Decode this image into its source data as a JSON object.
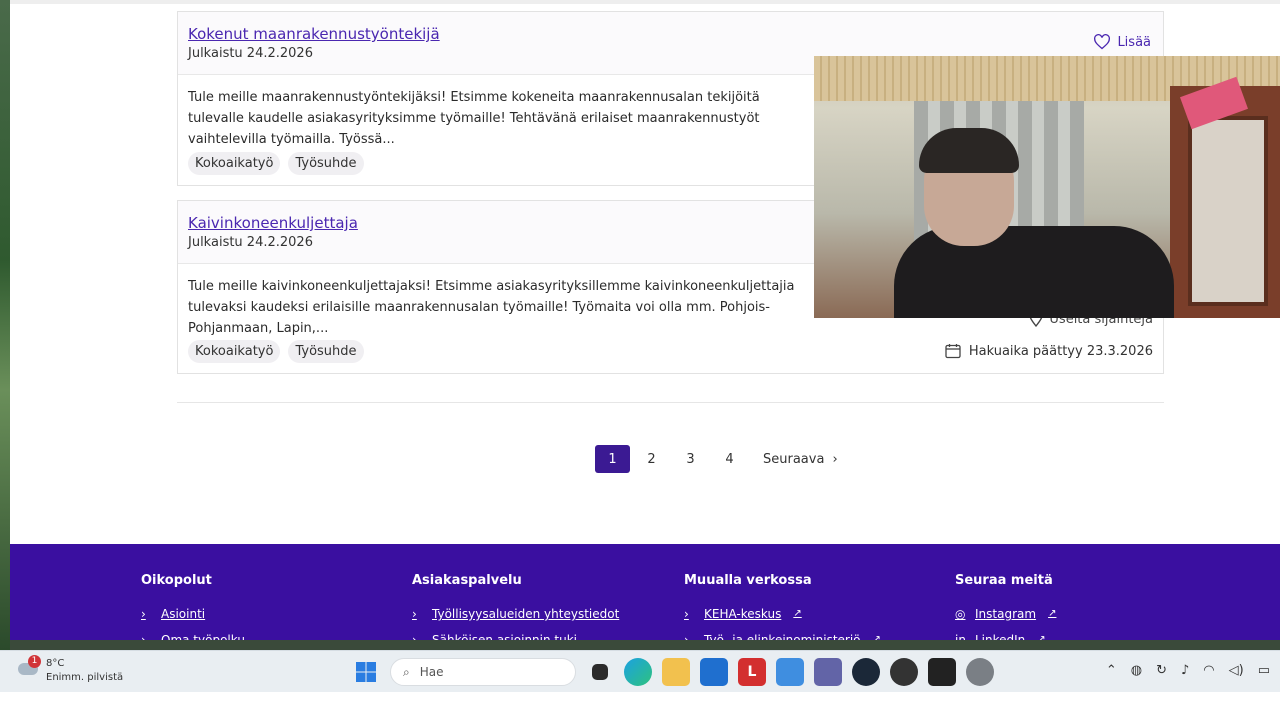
{
  "cards": [
    {
      "title": "Kokenut maanrakennustyöntekijä",
      "date": "Julkaistu 24.2.2026",
      "description": "Tule meille maanrakennustyöntekijäksi! Etsimme kokeneita maanrakennusalan tekijöitä tulevalle kaudelle asiakasyrityksimme työmaille! Tehtävänä erilaiset maanrakennustyöt vaihtelevilla työmailla. Työssä...",
      "tags": [
        "Kokoaikatyö",
        "Työsuhde"
      ],
      "favorite_label": "Lisää"
    },
    {
      "title": "Kaivinkoneenkuljettaja",
      "date": "Julkaistu 24.2.2026",
      "description": "Tule meille kaivinkoneenkuljettajaksi! Etsimme asiakasyrityksillemme kaivinkoneenkuljettajia tulevaksi kaudeksi erilaisille maanrakennusalan työmaille! Työmaita voi olla mm. Pohjois-Pohjanmaan, Lapin,...",
      "tags": [
        "Kokoaikatyö",
        "Työsuhde"
      ],
      "locations_label": "Useita sijainteja",
      "deadline": "Hakuaika päättyy 23.3.2026"
    }
  ],
  "pagination": {
    "pages": [
      "1",
      "2",
      "3",
      "4"
    ],
    "active": "1",
    "next": "Seuraava"
  },
  "footer": {
    "columns": [
      {
        "heading": "Oikopolut",
        "links": [
          "Asiointi",
          "Oma työpolku"
        ]
      },
      {
        "heading": "Asiakaspalvelu",
        "links": [
          "Työllisyysalueiden yhteystiedot",
          "Sähköisen asioinnin tuki"
        ]
      },
      {
        "heading": "Muualla verkossa",
        "links": [
          "KEHA-keskus",
          "Työ- ja elinkeinoministeriö"
        ]
      },
      {
        "heading": "Seuraa meitä",
        "links": [
          "Instagram",
          "LinkedIn"
        ]
      }
    ]
  },
  "taskbar": {
    "weather_temp": "8°C",
    "weather_desc": "Enimm. pilvistä",
    "weather_badge": "1",
    "search_placeholder": "Hae",
    "app_l_label": "L"
  },
  "colors": {
    "brand": "#3a0fa0",
    "link": "#4a27b0",
    "active_page": "#3b1a93"
  }
}
